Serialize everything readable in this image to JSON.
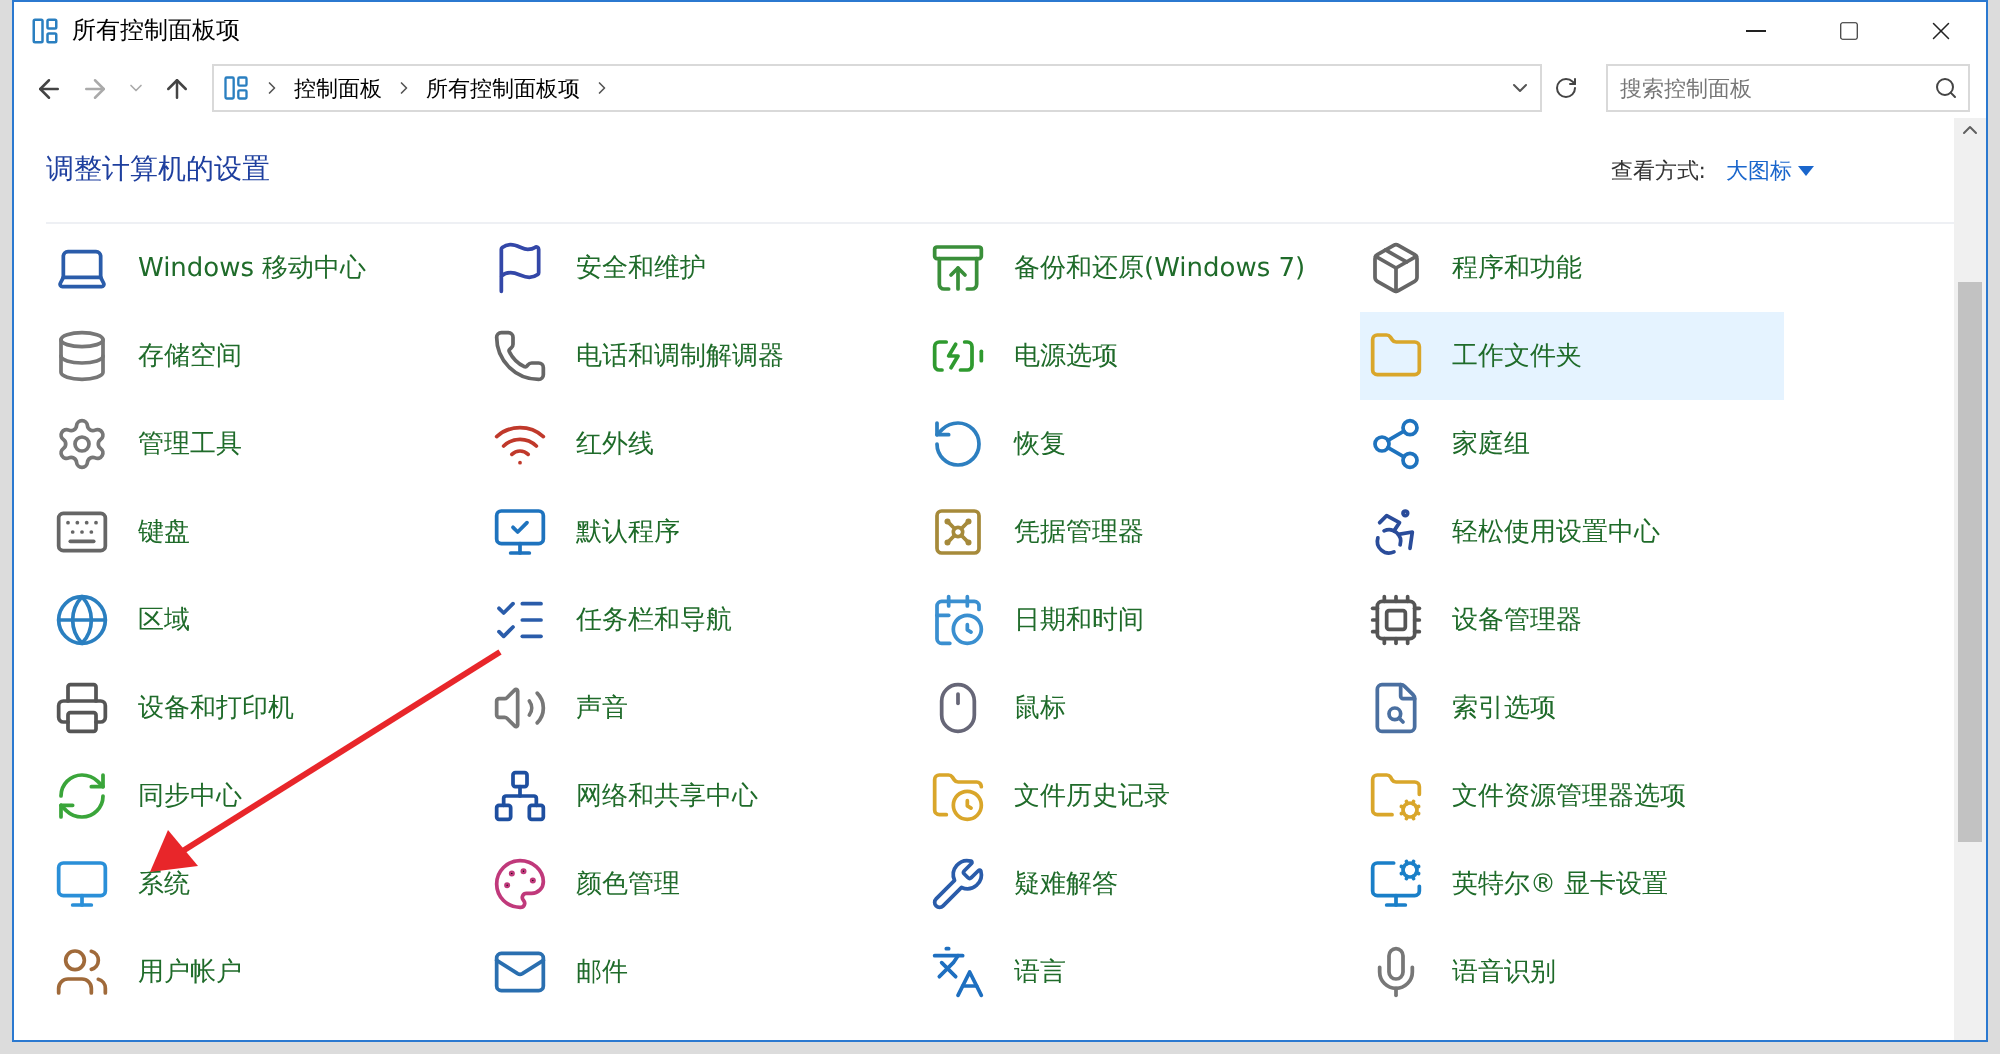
{
  "window": {
    "title": "所有控制面板项"
  },
  "address_bar": {
    "crumbs": [
      "控制面板",
      "所有控制面板项"
    ]
  },
  "search": {
    "placeholder": "搜索控制面板"
  },
  "heading": "调整计算机的设置",
  "view_by": {
    "label": "查看方式:",
    "value": "大图标"
  },
  "items": [
    {
      "label": "Windows 移动中心",
      "selected": false
    },
    {
      "label": "安全和维护",
      "selected": false
    },
    {
      "label": "备份和还原(Windows 7)",
      "selected": false
    },
    {
      "label": "程序和功能",
      "selected": false
    },
    {
      "label": "存储空间",
      "selected": false
    },
    {
      "label": "电话和调制解调器",
      "selected": false
    },
    {
      "label": "电源选项",
      "selected": false
    },
    {
      "label": "工作文件夹",
      "selected": true
    },
    {
      "label": "管理工具",
      "selected": false
    },
    {
      "label": "红外线",
      "selected": false
    },
    {
      "label": "恢复",
      "selected": false
    },
    {
      "label": "家庭组",
      "selected": false
    },
    {
      "label": "键盘",
      "selected": false
    },
    {
      "label": "默认程序",
      "selected": false
    },
    {
      "label": "凭据管理器",
      "selected": false
    },
    {
      "label": "轻松使用设置中心",
      "selected": false
    },
    {
      "label": "区域",
      "selected": false
    },
    {
      "label": "任务栏和导航",
      "selected": false
    },
    {
      "label": "日期和时间",
      "selected": false
    },
    {
      "label": "设备管理器",
      "selected": false
    },
    {
      "label": "设备和打印机",
      "selected": false
    },
    {
      "label": "声音",
      "selected": false
    },
    {
      "label": "鼠标",
      "selected": false
    },
    {
      "label": "索引选项",
      "selected": false
    },
    {
      "label": "同步中心",
      "selected": false
    },
    {
      "label": "网络和共享中心",
      "selected": false
    },
    {
      "label": "文件历史记录",
      "selected": false
    },
    {
      "label": "文件资源管理器选项",
      "selected": false
    },
    {
      "label": "系统",
      "selected": false
    },
    {
      "label": "颜色管理",
      "selected": false
    },
    {
      "label": "疑难解答",
      "selected": false
    },
    {
      "label": "英特尔® 显卡设置",
      "selected": false
    },
    {
      "label": "用户帐户",
      "selected": false
    },
    {
      "label": "邮件",
      "selected": false
    },
    {
      "label": "语言",
      "selected": false
    },
    {
      "label": "语音识别",
      "selected": false
    }
  ]
}
